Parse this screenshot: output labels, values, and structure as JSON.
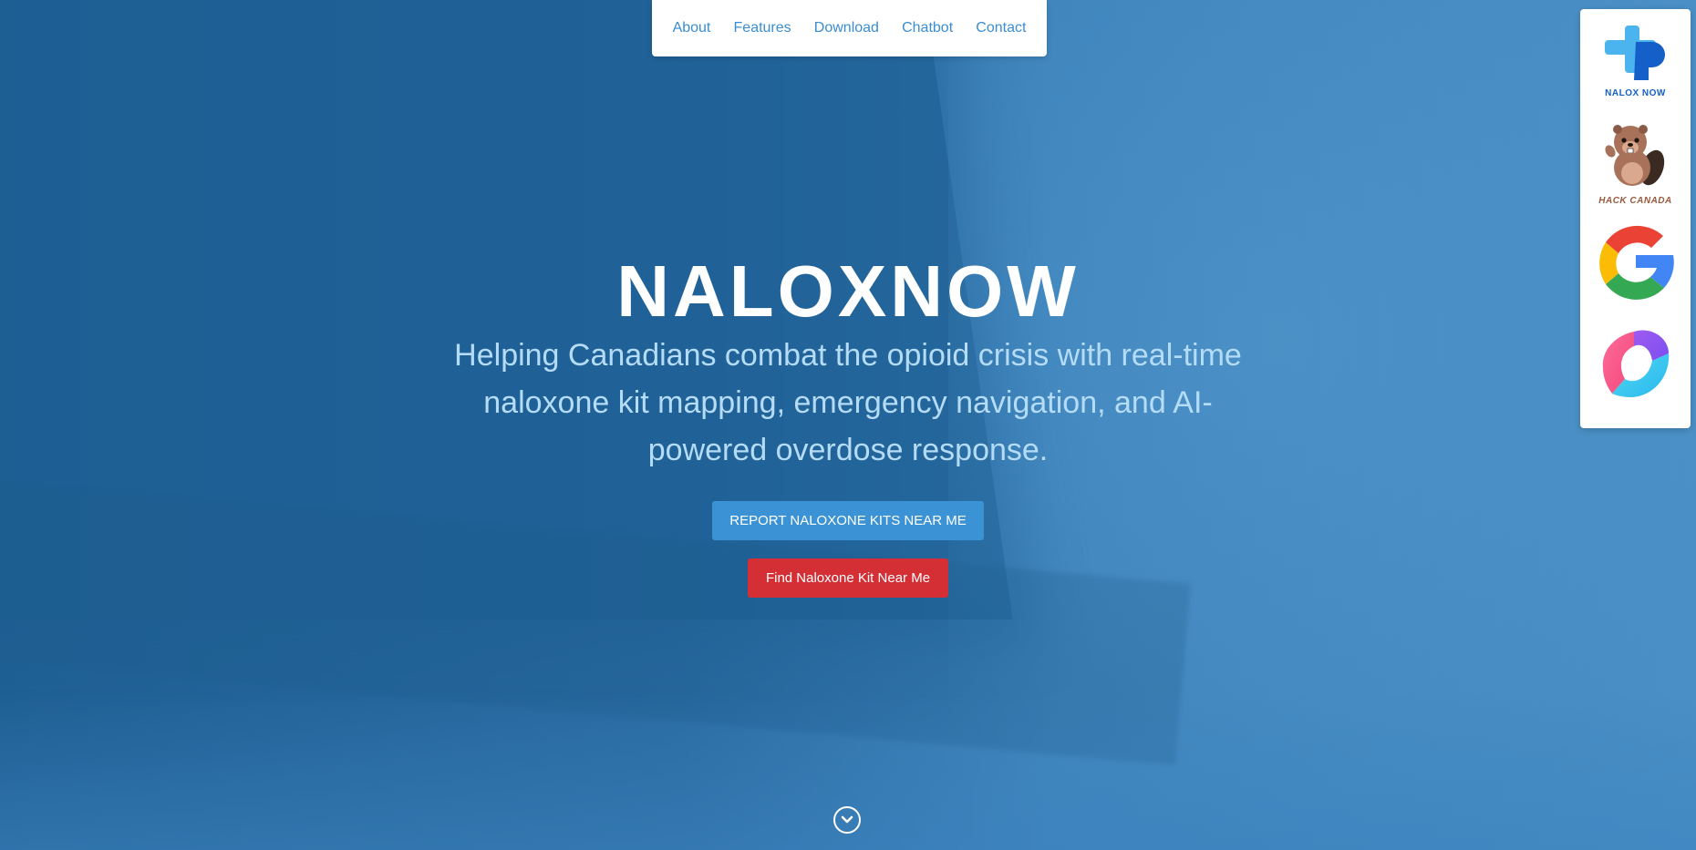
{
  "nav": {
    "items": [
      {
        "label": "About"
      },
      {
        "label": "Features"
      },
      {
        "label": "Download"
      },
      {
        "label": "Chatbot"
      },
      {
        "label": "Contact"
      }
    ]
  },
  "hero": {
    "title": "NALOXNOW",
    "subtitle": "Helping Canadians combat the opioid crisis with real-time naloxone kit mapping, emergency navigation, and AI-powered overdose response.",
    "report_button": "REPORT NALOXONE KITS NEAR ME",
    "find_button": "Find Naloxone Kit Near Me"
  },
  "sponsors": [
    {
      "icon": "naloxnow-logo-icon",
      "caption": "NALOX NOW"
    },
    {
      "icon": "hack-canada-beaver-icon",
      "caption": "HACK CANADA"
    },
    {
      "icon": "google-logo-icon",
      "caption": ""
    },
    {
      "icon": "gradient-blob-logo-icon",
      "caption": ""
    }
  ],
  "colors": {
    "nav_link": "#3a8dd0",
    "report_button": "#3b93d6",
    "find_button": "#d32f35",
    "subtitle": "#b5dcf6"
  },
  "icons": {
    "scroll": "chevron-down-circle-icon"
  }
}
